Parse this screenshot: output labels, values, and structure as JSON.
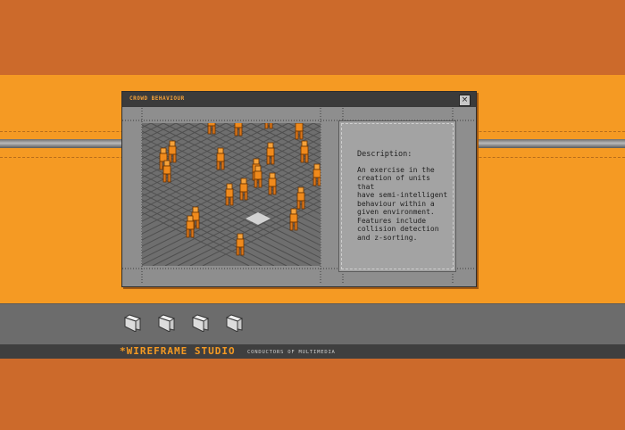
{
  "window": {
    "title": "Crowd Behaviour",
    "close_symbol": "×"
  },
  "description": {
    "heading": "Description:",
    "body": "An exercise in the\ncreation of units that\nhave semi-intelligent\nbehaviour within a\ngiven environment.",
    "features": "Features include\ncollision detection\nand z-sorting."
  },
  "dock": {
    "folders": [
      "folder-icon",
      "folder-icon",
      "folder-icon",
      "folder-icon"
    ]
  },
  "footer": {
    "brand": "*WIREFRAME STUDIO",
    "tagline": "Conductors of Multimedia"
  },
  "colors": {
    "orange": "#f59a23",
    "dark_orange": "#cc6a2b",
    "figure": "#f08a1c",
    "gray_dark": "#3b3b3b"
  }
}
